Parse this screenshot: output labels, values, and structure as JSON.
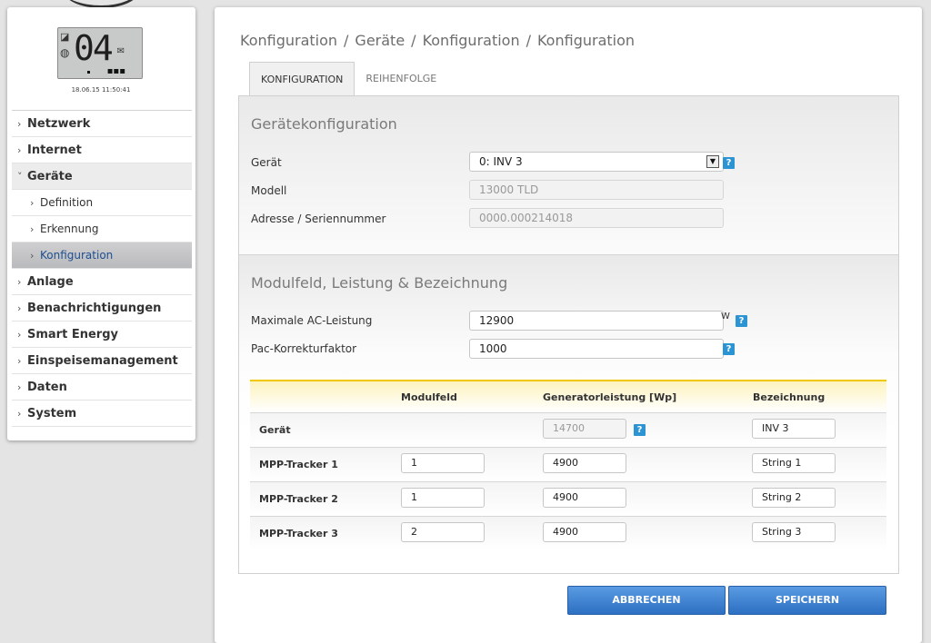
{
  "device_display": {
    "lcd_value": "04",
    "datetime": "18.06.15 11:50:41"
  },
  "sidebar": {
    "items": [
      {
        "label": "Netzwerk"
      },
      {
        "label": "Internet"
      },
      {
        "label": "Geräte"
      },
      {
        "label": "Definition"
      },
      {
        "label": "Erkennung"
      },
      {
        "label": "Konfiguration"
      },
      {
        "label": "Anlage"
      },
      {
        "label": "Benachrichtigungen"
      },
      {
        "label": "Smart Energy"
      },
      {
        "label": "Einspeisemanagement"
      },
      {
        "label": "Daten"
      },
      {
        "label": "System"
      }
    ]
  },
  "breadcrumb": [
    "Konfiguration",
    "Geräte",
    "Konfiguration",
    "Konfiguration"
  ],
  "tabs": [
    {
      "label": "KONFIGURATION"
    },
    {
      "label": "REIHENFOLGE"
    }
  ],
  "device_config": {
    "title": "Gerätekonfiguration",
    "device_label": "Gerät",
    "device_value": "0: INV 3",
    "model_label": "Modell",
    "model_value": "13000 TLD",
    "address_label": "Adresse / Seriennummer",
    "address_value": "0000.000214018"
  },
  "module_section": {
    "title": "Modulfeld, Leistung & Bezeichnung",
    "max_ac_label": "Maximale AC-Leistung",
    "max_ac_value": "12900",
    "max_ac_unit": "W",
    "pac_label": "Pac-Korrekturfaktor",
    "pac_value": "1000",
    "table": {
      "headers": [
        "Modulfeld",
        "Generatorleistung [Wp]",
        "Bezeichnung"
      ],
      "device_row": {
        "label": "Gerät",
        "generator": "14700",
        "name": "INV 3"
      },
      "rows": [
        {
          "label": "MPP-Tracker 1",
          "modulfeld": "1",
          "generator": "4900",
          "name": "String 1"
        },
        {
          "label": "MPP-Tracker 2",
          "modulfeld": "1",
          "generator": "4900",
          "name": "String 2"
        },
        {
          "label": "MPP-Tracker 3",
          "modulfeld": "2",
          "generator": "4900",
          "name": "String 3"
        }
      ]
    }
  },
  "buttons": {
    "cancel": "ABBRECHEN",
    "save": "SPEICHERN"
  },
  "help_icon": "?",
  "colors": {
    "accent": "#2d94d4",
    "button": "#3a7fd0",
    "active_link": "#1d4e8f",
    "table_header_border": "#f1c800"
  }
}
